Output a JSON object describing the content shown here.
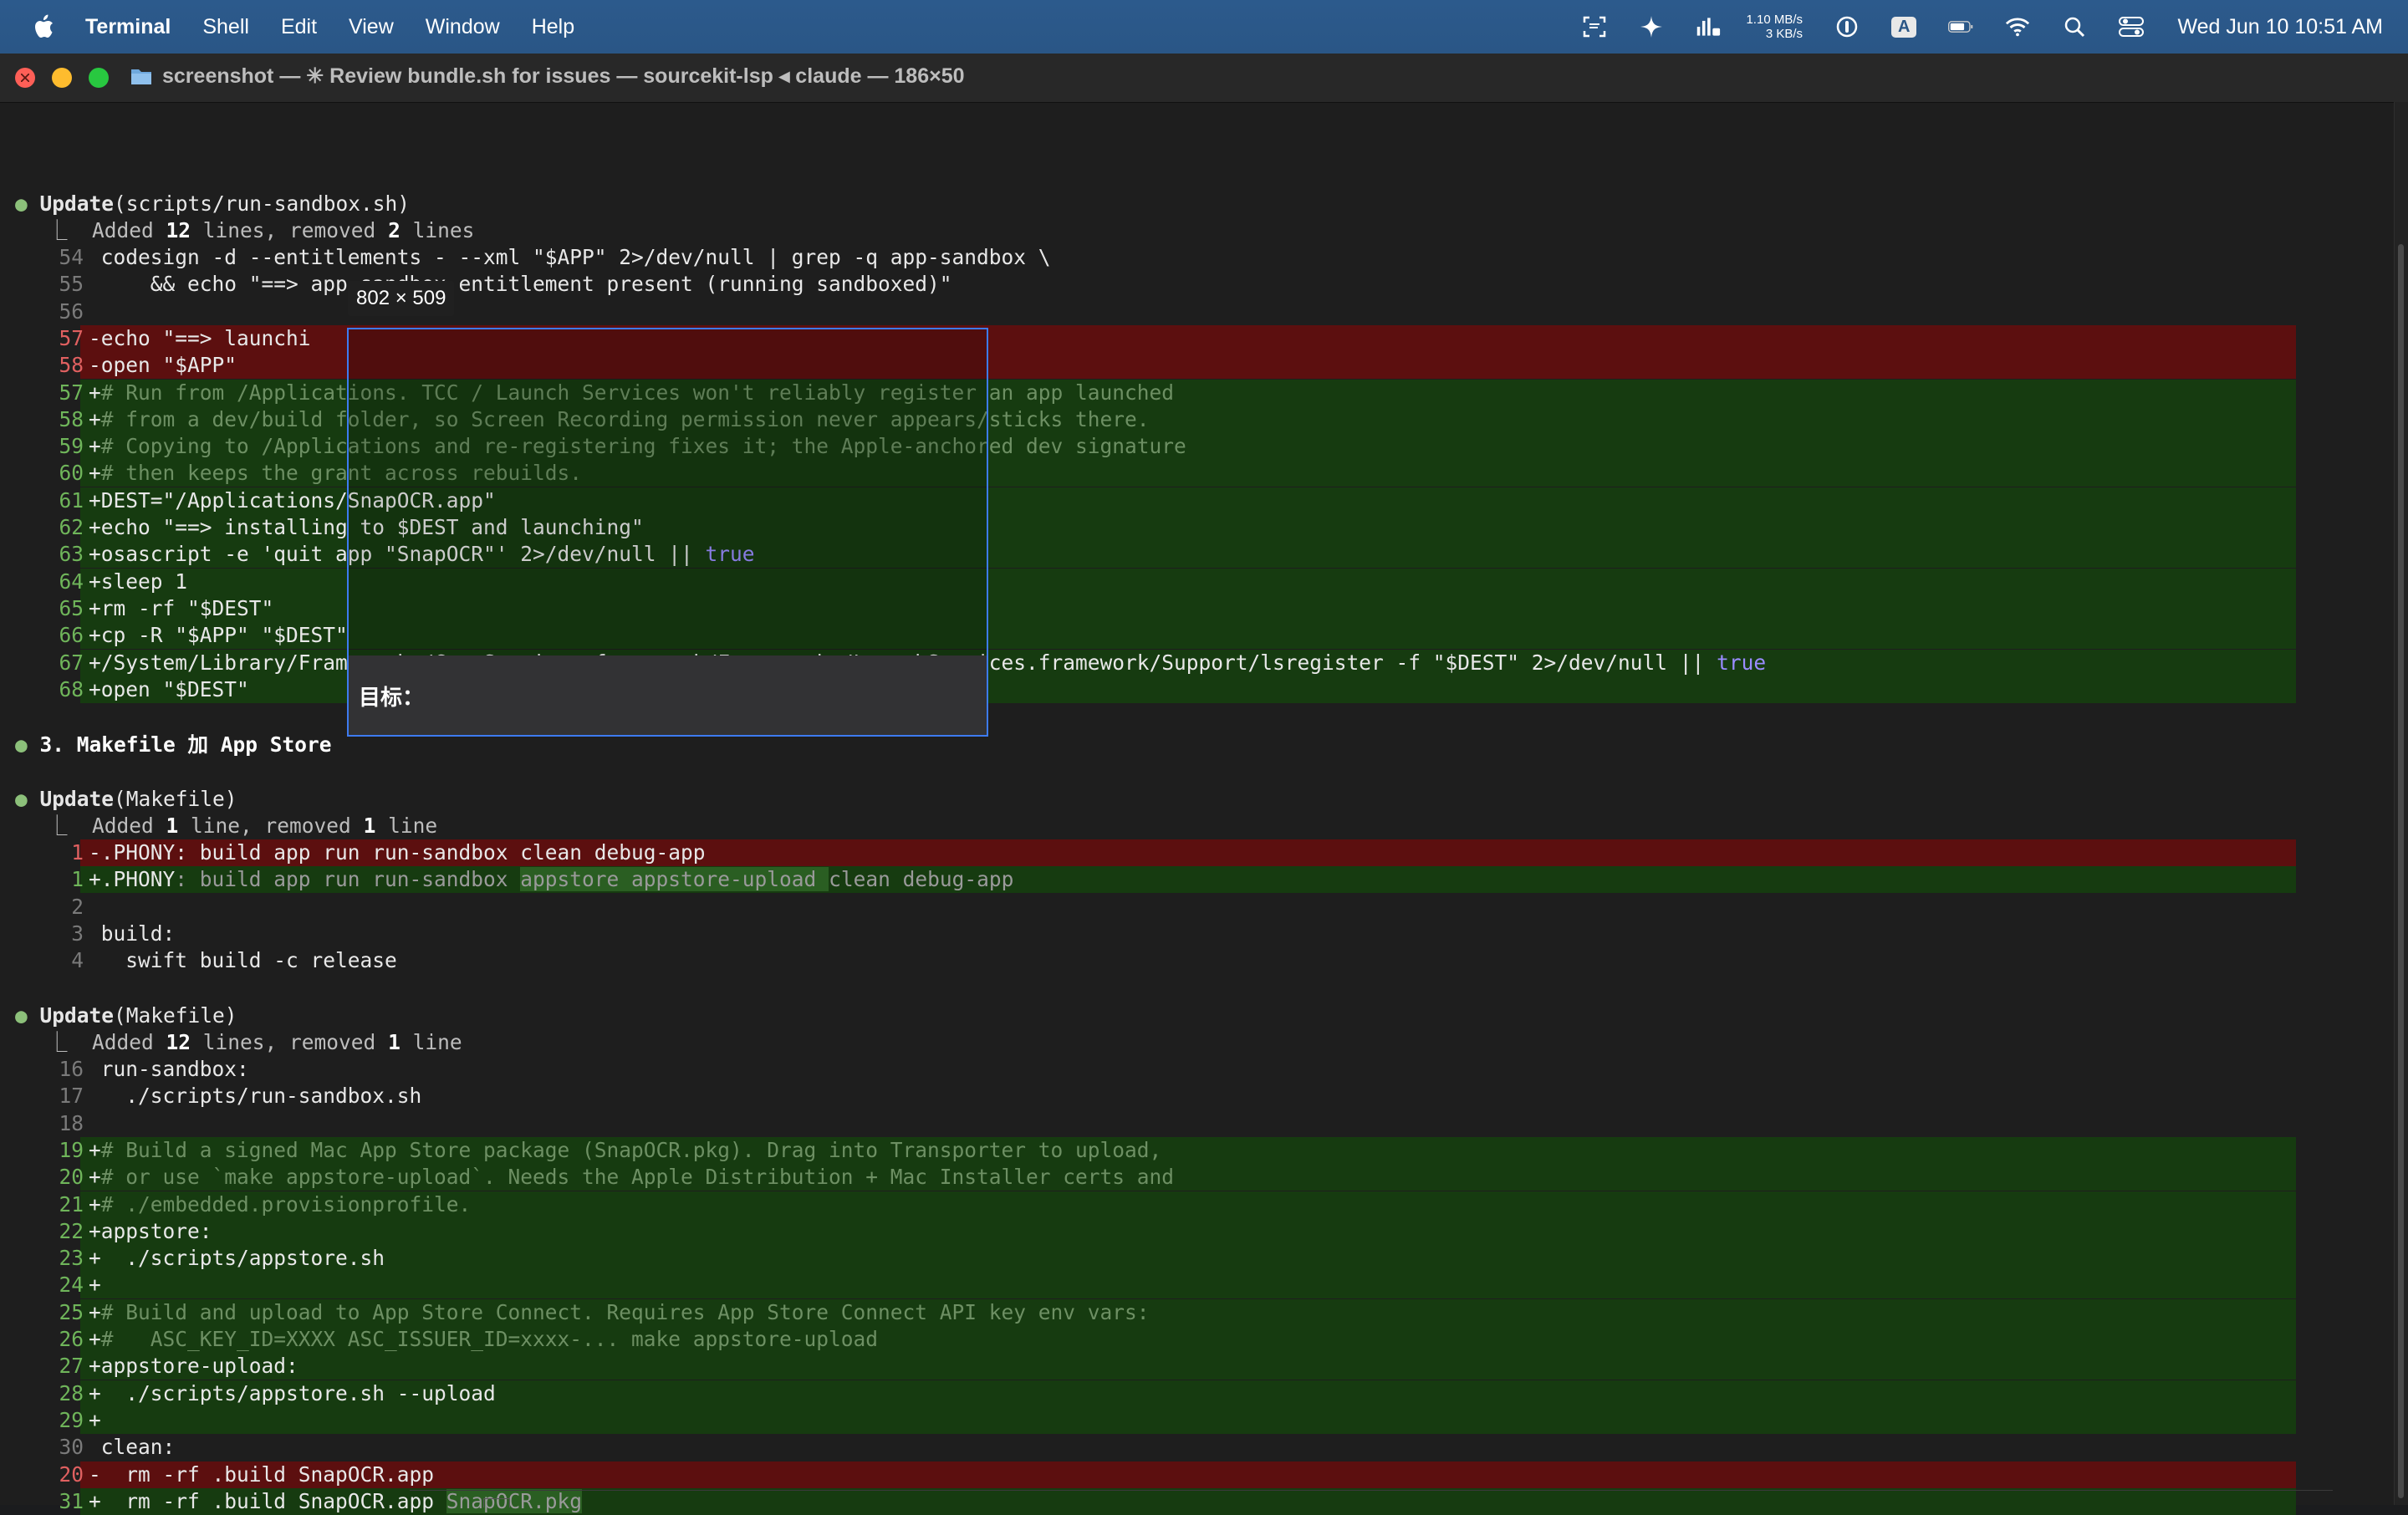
{
  "menubar": {
    "app_name": "Terminal",
    "menus": [
      "Shell",
      "Edit",
      "View",
      "Window",
      "Help"
    ],
    "net_up": "1.10 MB/s",
    "net_down": "3 KB/s",
    "input_badge": "A",
    "datetime": "Wed Jun 10  10:51 AM"
  },
  "window": {
    "title": "screenshot — ✳ Review bundle.sh for issues — sourcekit-lsp ◂ claude — 186×50"
  },
  "overlay": {
    "dimensions": "802 × 509",
    "caption": "目标："
  },
  "sections": {
    "s1_header_kw": "Update",
    "s1_header_arg": "(scripts/run-sandbox.sh)",
    "s1_summary": [
      "Added ",
      "12",
      " lines, removed ",
      "2",
      " lines"
    ],
    "s3_title": "3. Makefile 加 App Store",
    "s4_header_kw": "Update",
    "s4_header_arg": "(Makefile)",
    "s4_summary": [
      "Added ",
      "1",
      " line, removed ",
      "1",
      " line"
    ],
    "s5_header_kw": "Update",
    "s5_header_arg": "(Makefile)",
    "s5_summary": [
      "Added ",
      "12",
      " lines, removed ",
      "1",
      " line"
    ]
  },
  "diff1": [
    {
      "n": "54",
      "t": "ctx",
      "code": "codesign -d --entitlements - --xml \"$APP\" 2>/dev/null | grep -q app-sandbox \\"
    },
    {
      "n": "55",
      "t": "ctx",
      "code": "    && echo \"==> app-sandbox entitlement present (running sandboxed)\""
    },
    {
      "n": "56",
      "t": "ctx",
      "code": ""
    },
    {
      "n": "57",
      "t": "del",
      "code": "echo \"==> launchi"
    },
    {
      "n": "58",
      "t": "del",
      "code": "open \"$APP\""
    },
    {
      "n": "57",
      "t": "add",
      "code": "# Run from /Applications. TCC / Launch Services won't reliably register an app launched"
    },
    {
      "n": "58",
      "t": "add",
      "code": "# from a dev/build folder, so Screen Recording permission never appears/sticks there."
    },
    {
      "n": "59",
      "t": "add",
      "code": "# Copying to /Applications and re-registering fixes it; the Apple-anchored dev signature"
    },
    {
      "n": "60",
      "t": "add",
      "code": "# then keeps the grant across rebuilds."
    },
    {
      "n": "61",
      "t": "add",
      "code": "DEST=\"/Applications/SnapOCR.app\""
    },
    {
      "n": "62",
      "t": "add",
      "code": "echo \"==> installing to $DEST and launching\""
    },
    {
      "n": "63",
      "t": "add",
      "code": "osascript -e 'quit app \"SnapOCR\"' 2>/dev/null || ",
      "tail": "true"
    },
    {
      "n": "64",
      "t": "add",
      "code": "sleep 1"
    },
    {
      "n": "65",
      "t": "add",
      "code": "rm -rf \"$DEST\""
    },
    {
      "n": "66",
      "t": "add",
      "code": "cp -R \"$APP\" \"$DEST\""
    },
    {
      "n": "67",
      "t": "add",
      "code": "/System/Library/Frameworks/CoreServices.framework/Frameworks/LaunchServices.framework/Support/lsregister -f \"$DEST\" 2>/dev/null || ",
      "tail": "true"
    },
    {
      "n": "68",
      "t": "add",
      "code": "open \"$DEST\""
    }
  ],
  "diff2": [
    {
      "n": "1",
      "t": "del",
      "code": ".PHONY: build app run run-sandbox clean debug-app"
    },
    {
      "n": "1",
      "t": "add",
      "pre": ".PHONY",
      "code": ": build app run run-sandbox ",
      "hl": "appstore appstore-upload ",
      "post": "clean debug-app"
    },
    {
      "n": "2",
      "t": "ctx",
      "code": ""
    },
    {
      "n": "3",
      "t": "ctx",
      "code": "build:"
    },
    {
      "n": "4",
      "t": "ctx",
      "code": "  swift build -c release"
    }
  ],
  "diff3": [
    {
      "n": "16",
      "t": "ctx",
      "code": "run-sandbox:"
    },
    {
      "n": "17",
      "t": "ctx",
      "code": "  ./scripts/run-sandbox.sh"
    },
    {
      "n": "18",
      "t": "ctx",
      "code": ""
    },
    {
      "n": "19",
      "t": "add",
      "code": "# Build a signed Mac App Store package (SnapOCR.pkg). Drag into Transporter to upload,"
    },
    {
      "n": "20",
      "t": "add",
      "code": "# or use `make appstore-upload`. Needs the Apple Distribution + Mac Installer certs and"
    },
    {
      "n": "21",
      "t": "add",
      "code": "# ./embedded.provisionprofile."
    },
    {
      "n": "22",
      "t": "add",
      "code": "appstore:"
    },
    {
      "n": "23",
      "t": "add",
      "code": "  ./scripts/appstore.sh"
    },
    {
      "n": "24",
      "t": "add",
      "code": ""
    },
    {
      "n": "25",
      "t": "add",
      "code": "# Build and upload to App Store Connect. Requires App Store Connect API key env vars:"
    },
    {
      "n": "26",
      "t": "add",
      "code": "#   ASC_KEY_ID=XXXX ASC_ISSUER_ID=xxxx-... make appstore-upload"
    },
    {
      "n": "27",
      "t": "add",
      "code": "appstore-upload:"
    },
    {
      "n": "28",
      "t": "add",
      "code": "  ./scripts/appstore.sh --upload"
    },
    {
      "n": "29",
      "t": "add",
      "code": ""
    },
    {
      "n": "30",
      "t": "ctx",
      "code": "clean:"
    },
    {
      "n": "20",
      "t": "del",
      "code": "  rm -rf .build SnapOCR.app"
    },
    {
      "n": "31",
      "t": "add",
      "code": "  rm -rf .build SnapOCR.app ",
      "hl": "SnapOCR.pkg"
    }
  ],
  "colors": {
    "menubar": "#2a5686",
    "del_band": "#5c0f0f",
    "add_band": "#163b10",
    "selection_border": "#3d7bf0"
  }
}
